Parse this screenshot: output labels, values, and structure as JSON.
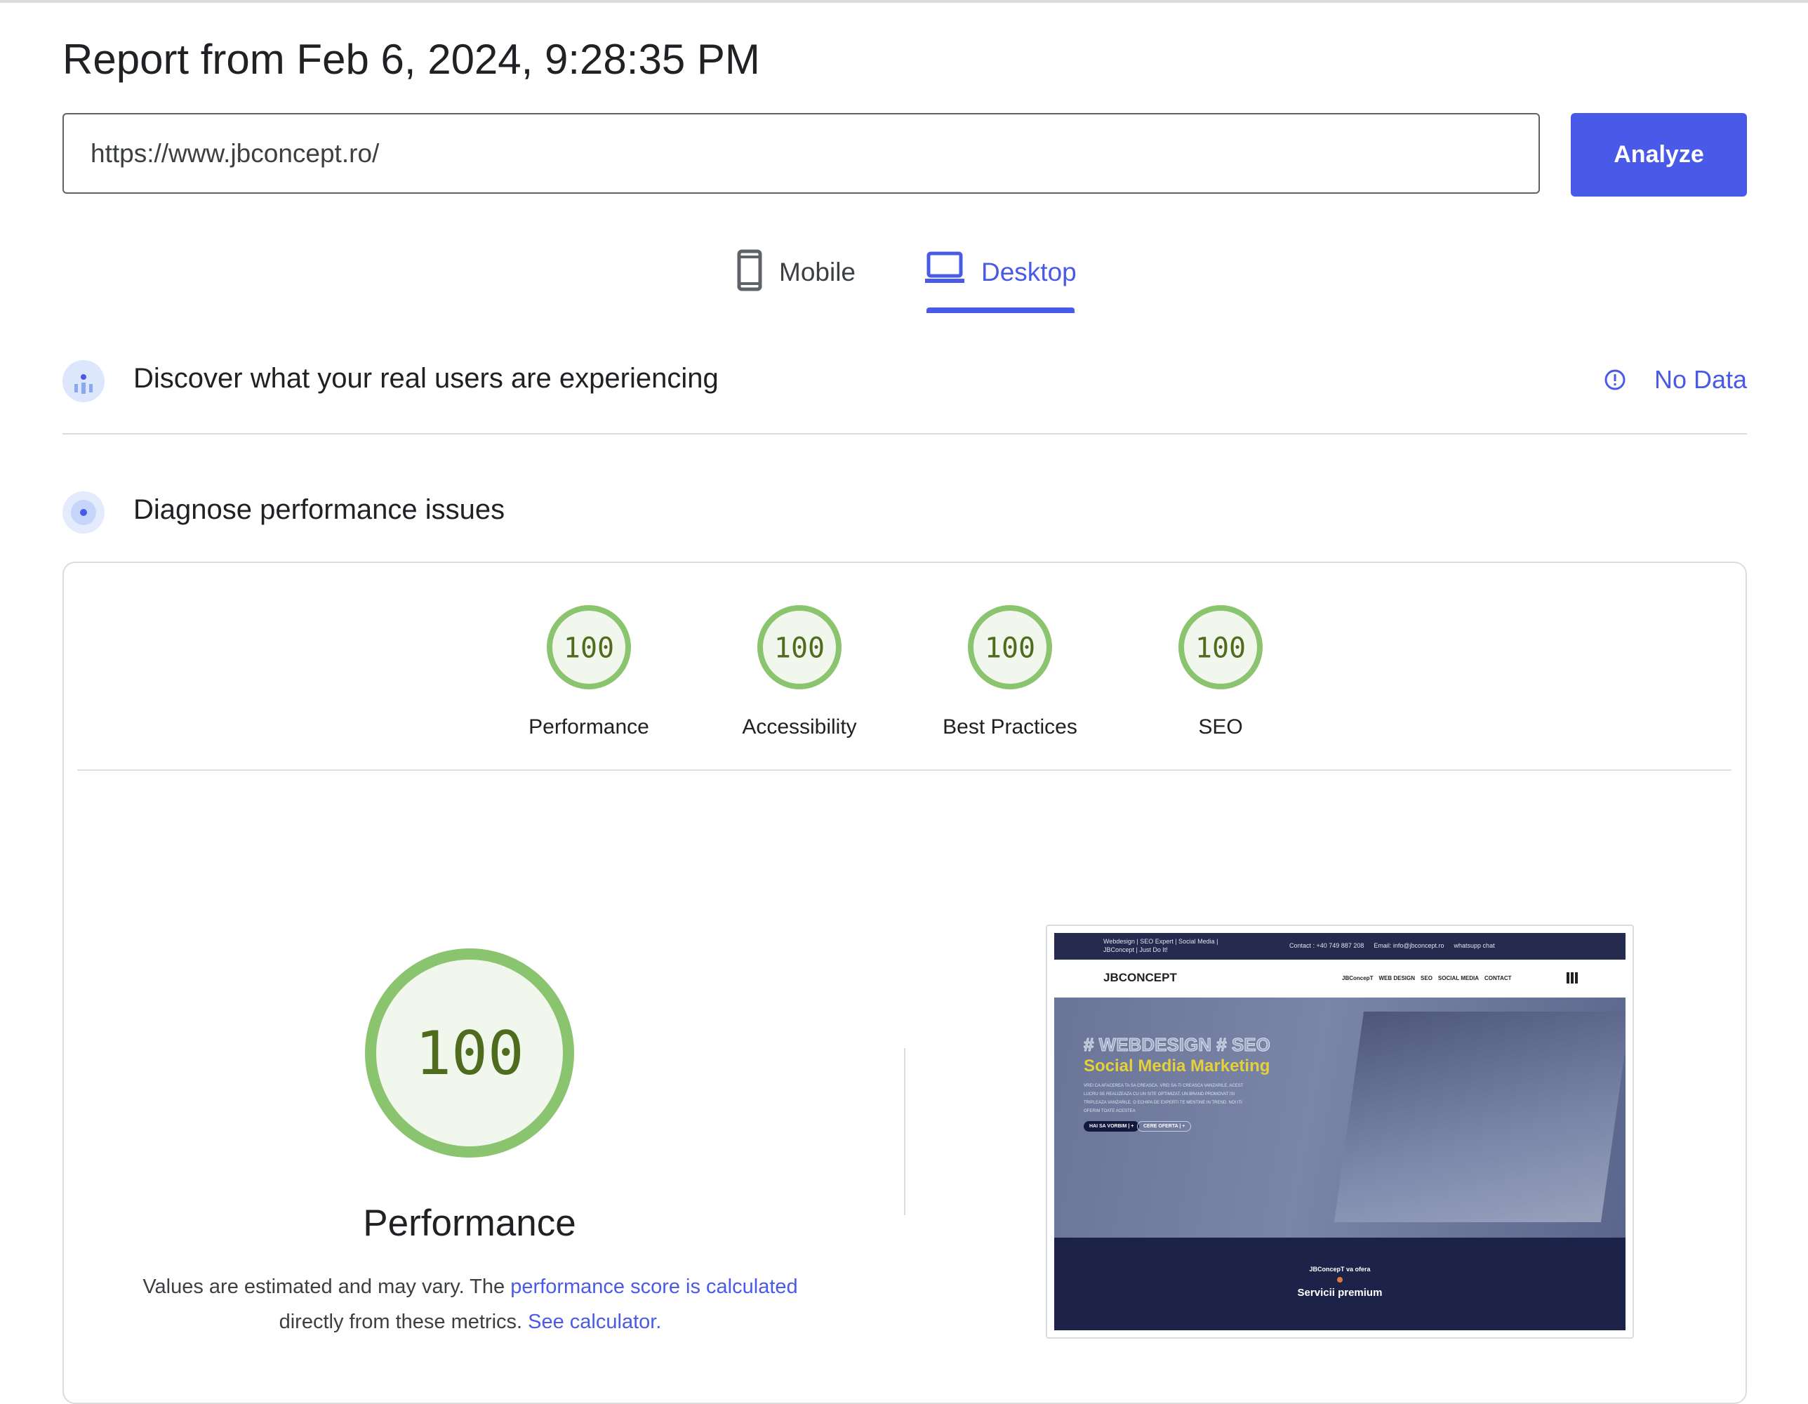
{
  "header": {
    "title": "Report from Feb 6, 2024, 9:28:35 PM"
  },
  "url_input": {
    "value": "https://www.jbconcept.ro/"
  },
  "analyze_button": {
    "label": "Analyze"
  },
  "tabs": [
    {
      "label": "Mobile",
      "icon": "smartphone-icon",
      "selected": false
    },
    {
      "label": "Desktop",
      "icon": "laptop-icon",
      "selected": true
    }
  ],
  "field_data": {
    "title": "Discover what your real users are experiencing",
    "status": "No Data",
    "icon": "users-icon"
  },
  "lab_data": {
    "title": "Diagnose performance issues",
    "icon": "gauge-icon"
  },
  "scores": [
    {
      "label": "Performance",
      "value": "100"
    },
    {
      "label": "Accessibility",
      "value": "100"
    },
    {
      "label": "Best Practices",
      "value": "100"
    },
    {
      "label": "SEO",
      "value": "100"
    }
  ],
  "performance": {
    "score": "100",
    "title": "Performance",
    "desc_prefix": "Values are estimated and may vary. The ",
    "desc_link1": "performance score is calculated",
    "desc_middle": " directly from these metrics. ",
    "desc_link2": "See calculator."
  },
  "colors": {
    "accent": "#4a5ae8",
    "pass": "#8bc46e",
    "pass_fill": "#f1f7ed",
    "pass_text": "#4e6b1e"
  },
  "screenshot": {
    "top_left": "Webdesign | SEO Expert | Social Media | JBConcept | Just Do It!",
    "contact": "Contact : +40 749 887 208",
    "email": "Email: info@jbconcept.ro",
    "whatsapp": "whatsupp chat",
    "logo": "JBCONCEPT",
    "nav": [
      "JBConcepT",
      "WEB DESIGN",
      "SEO",
      "SOCIAL MEDIA",
      "CONTACT"
    ],
    "hero_outline": "# WEBDESIGN # SEO",
    "hero_title": "Social Media Marketing",
    "hero_text": "VREI CA AFACEREA TA SA CREASCA. VREI SA-TI CREASCA VANZARILE. ACEST LUCRU SE REALIZEAZA CU UN SITE OPTIMIZAT. UN BRAND PROMOVAT ISI TRIPLEAZA VANZARILE. O ECHIPA DE EXPERTI TE MENTINE IN TREND. NOI ITI OFERIM TOATE ACESTEA",
    "btn1": "HAI SA VORBIM | +",
    "btn2": "CERE OFERTA | +",
    "foot_small": "JBConcepT va ofera",
    "foot_title": "Servicii premium"
  }
}
